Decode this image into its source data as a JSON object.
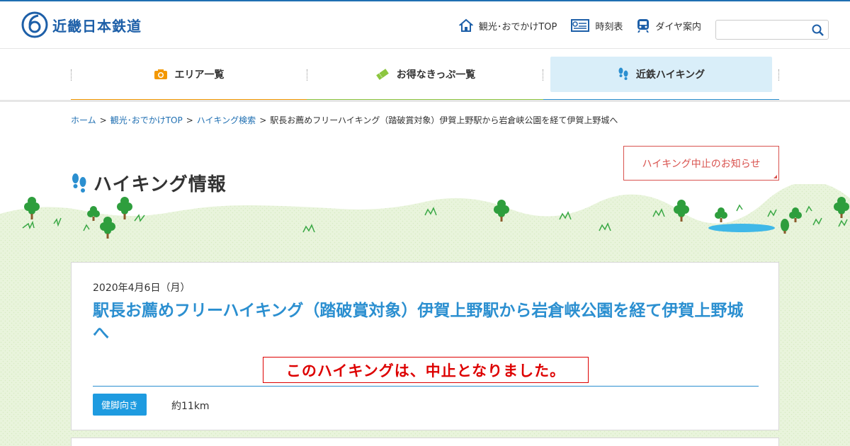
{
  "header": {
    "logo_text": "近畿日本鉄道",
    "util_links": [
      {
        "label": "観光･おでかけTOP",
        "icon": "house-icon"
      },
      {
        "label": "時刻表",
        "icon": "timetable-icon"
      },
      {
        "label": "ダイヤ案内",
        "icon": "train-icon"
      }
    ],
    "search_placeholder": ""
  },
  "main_nav": {
    "items": [
      {
        "label": "エリア一覧",
        "icon": "camera-icon",
        "color": "#f39800"
      },
      {
        "label": "お得なきっぷ一覧",
        "icon": "ticket-icon",
        "color": "#8cc63f"
      },
      {
        "label": "近鉄ハイキング",
        "icon": "footprints-icon",
        "color": "#2b8fd0"
      }
    ]
  },
  "breadcrumb": {
    "items": [
      "ホーム",
      "観光･おでかけTOP",
      "ハイキング検索"
    ],
    "current": "駅長お薦めフリーハイキング（踏破賞対象）伊賀上野駅から岩倉峡公園を経て伊賀上野城へ"
  },
  "notice_button": "ハイキング中止のお知らせ",
  "page_title": "ハイキング情報",
  "event": {
    "date": "2020年4月6日（月）",
    "title": "駅長お薦めフリーハイキング（踏破賞対象）伊賀上野駅から岩倉峡公園を経て伊賀上野城へ",
    "cancel_notice": "このハイキングは、中止となりました。",
    "level_tag": "健脚向き",
    "distance": "約11km"
  },
  "colors": {
    "brand_blue": "#1d5fa8",
    "accent_blue": "#2b8fd0",
    "alert_red": "#d00",
    "grass_green": "#e8f3d9"
  }
}
